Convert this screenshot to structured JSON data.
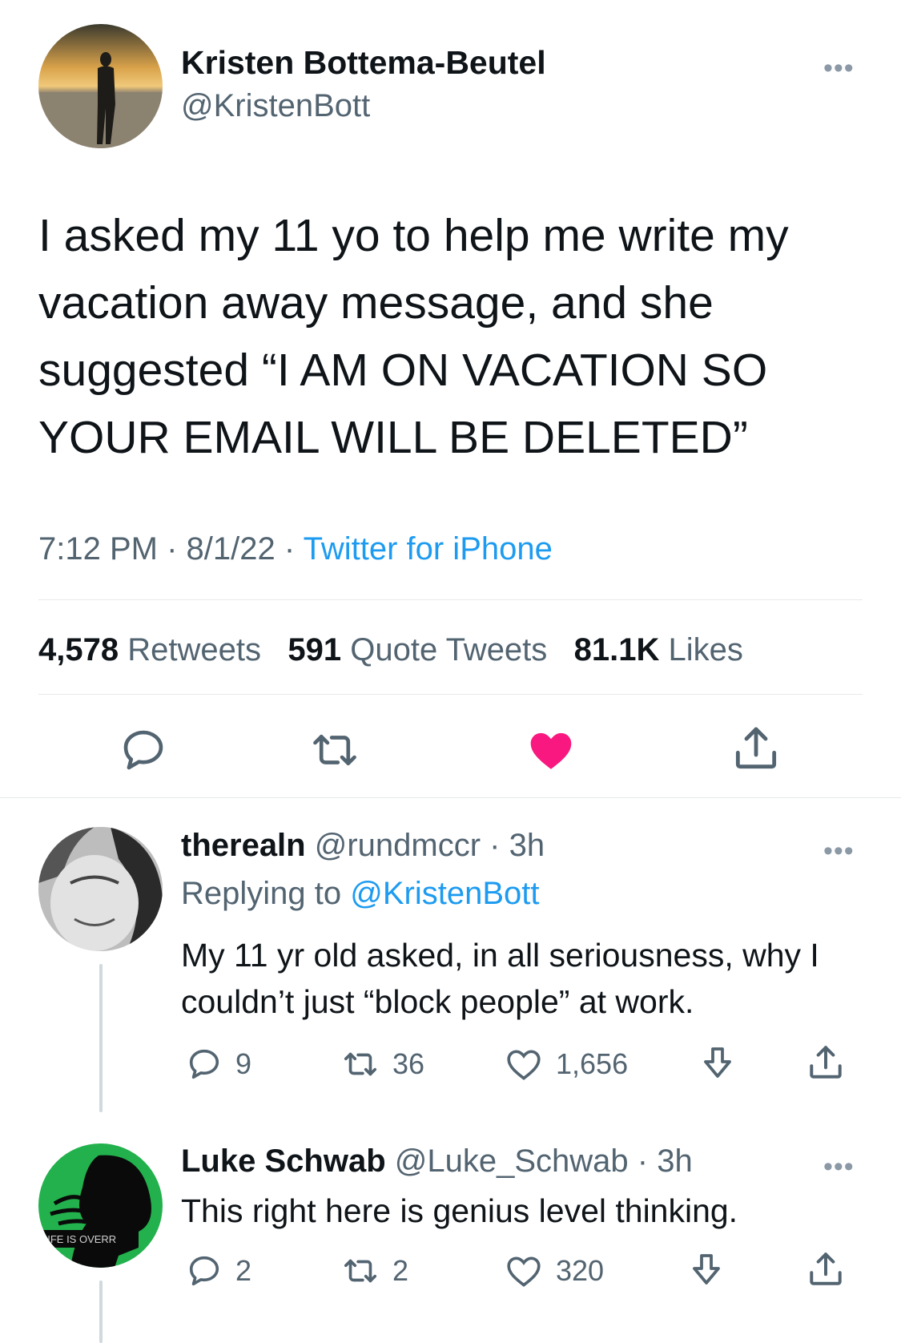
{
  "tweet": {
    "author_name": "Kristen Bottema-Beutel",
    "author_handle": "@KristenBott",
    "text": "I asked my 11 yo to help me write my vacation away message, and she suggested “I AM ON VACATION SO YOUR EMAIL WILL BE DELETED”",
    "time": "7:12 PM",
    "date": "8/1/22",
    "separator": "·",
    "source": "Twitter for iPhone",
    "retweets": "4,578",
    "retweets_label": "Retweets",
    "quotes": "591",
    "quotes_label": "Quote Tweets",
    "likes": "81.1K",
    "likes_label": "Likes",
    "like_color": "#f91880"
  },
  "replies": [
    {
      "name": "therealn",
      "handle": "@rundmccr",
      "time": "3h",
      "separator": "·",
      "replying_prefix": "Replying to",
      "replying_to": "@KristenBott",
      "text": "My 11 yr old asked, in all seriousness, why I couldn’t just “block people” at work.",
      "replies": "9",
      "retweets": "36",
      "likes": "1,656"
    },
    {
      "name": "Luke Schwab",
      "handle": "@Luke_Schwab",
      "time": "3h",
      "separator": "·",
      "text": "This right here is genius level thinking.",
      "replies": "2",
      "retweets": "2",
      "likes": "320",
      "avatar_text": "LIFE IS OVERR"
    }
  ],
  "icons": {
    "more": "more-icon",
    "reply": "reply-icon",
    "retweet": "retweet-icon",
    "like": "heart-icon",
    "downvote": "downvote-icon",
    "share": "share-icon"
  },
  "colors": {
    "link": "#1d9bf0",
    "secondary": "#536471",
    "divider": "#e6e9eb"
  }
}
